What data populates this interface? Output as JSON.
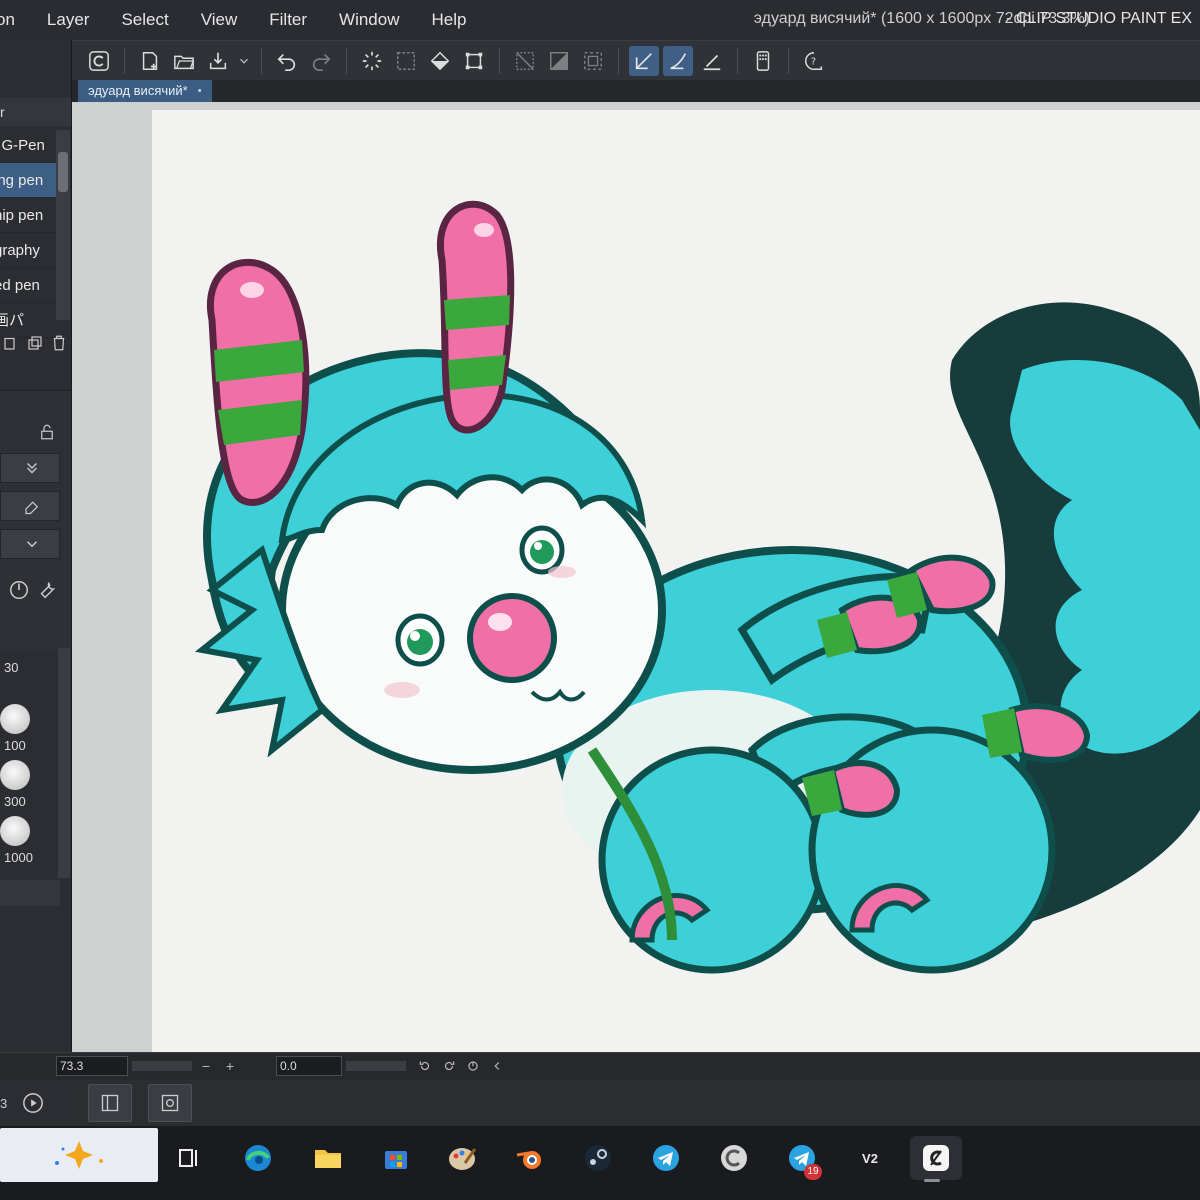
{
  "menu": {
    "items": [
      "on",
      "Layer",
      "Select",
      "View",
      "Filter",
      "Window",
      "Help"
    ]
  },
  "title": {
    "document": "эдуард висячий* (1600 x 1600px 72dpi 73.3%)",
    "app": "- CLIP STUDIO PAINT EX"
  },
  "toolbar": {
    "icons": [
      "clip-studio-icon",
      "new-file-icon",
      "open-folder-icon",
      "save-icon",
      "undo-icon",
      "redo-icon",
      "clear-selection-icon",
      "select-all-icon",
      "fill-icon",
      "transform-icon",
      "hide-selection-icon",
      "invert-selection-icon",
      "snap-ruler-icon",
      "snap-special-ruler-icon",
      "snap-grid-icon",
      "smartphone-icon",
      "help-icon"
    ]
  },
  "tab": {
    "label": "эдуард висячий*",
    "close": "•"
  },
  "left_panel": {
    "header": "r",
    "brushes": [
      "l G-Pen",
      "ing pen",
      "nip pen",
      "graphy",
      "ed pen",
      "画パ"
    ],
    "selected_index": 1,
    "sizes": [
      "30",
      "100",
      "300",
      "1000"
    ]
  },
  "status": {
    "zoom": "73.3",
    "angle": "0.0",
    "minus": "−",
    "plus": "+"
  },
  "dock": {
    "num": "3"
  },
  "taskbar": {
    "apps": [
      "widgets",
      "task-view",
      "edge",
      "file-explorer",
      "microsoft-store",
      "paint",
      "blender",
      "steam",
      "telegram",
      "clip-studio-launcher",
      "telegram-2",
      "v2",
      "clip-studio-paint"
    ],
    "v2_label": "V2",
    "telegram_badge": "19"
  },
  "colors": {
    "cyan": "#3ed0d8",
    "outline": "#0e4f4c",
    "pink": "#ef6fa6",
    "green": "#3aa83c",
    "accent": "#3d5f86"
  }
}
